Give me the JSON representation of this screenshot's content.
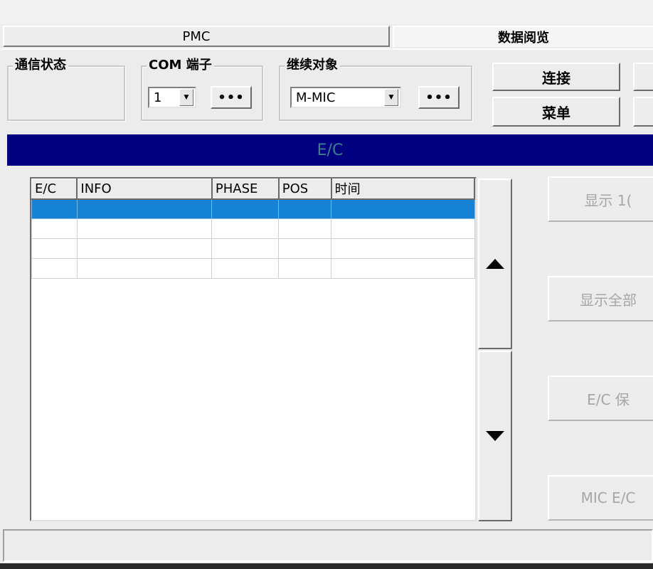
{
  "tabs": [
    {
      "label": "PMC",
      "active": false
    },
    {
      "label": "数据阅览",
      "active": true
    }
  ],
  "comm_status": {
    "legend": "通信状态"
  },
  "com_port": {
    "legend": "COM 端子",
    "value": "1",
    "more_label": "•••"
  },
  "target": {
    "legend": "继续对象",
    "value": "M-MIC",
    "more_label": "•••"
  },
  "actions": {
    "connect_label": "连接",
    "menu_label": "菜单"
  },
  "ec_bar": {
    "title": "E/C",
    "bg_color": "#000080"
  },
  "grid": {
    "columns": [
      "E/C",
      "INFO",
      "PHASE",
      "POS",
      "时间"
    ],
    "rows": [
      [
        "",
        "",
        "",
        "",
        ""
      ],
      [
        "",
        "",
        "",
        "",
        ""
      ],
      [
        "",
        "",
        "",
        "",
        ""
      ],
      [
        "",
        "",
        "",
        "",
        ""
      ]
    ],
    "selected_row": 0,
    "selection_color": "#1582d6"
  },
  "side_buttons": {
    "show_10": "显示 1(",
    "show_all": "显示全部",
    "ec_save": "E/C 保",
    "mic_ec": "MIC E/C"
  },
  "scroll": {
    "up_icon": "triangle-up-icon",
    "down_icon": "triangle-down-icon"
  }
}
